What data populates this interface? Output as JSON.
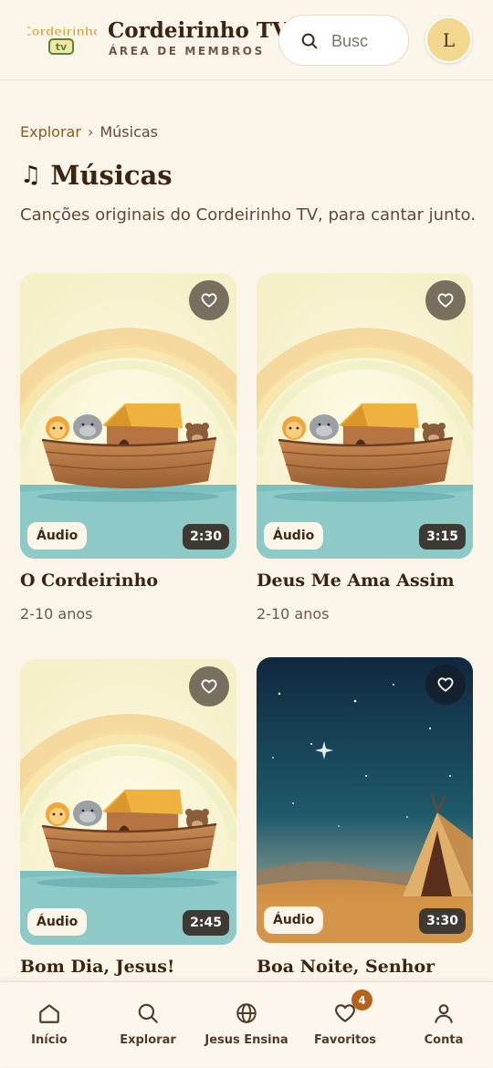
{
  "header": {
    "logo_text_top": "Cordeirinho",
    "logo_text_bottom": "tv",
    "brand_title": "Cordeirinho TV",
    "brand_subtitle": "ÁREA DE MEMBROS",
    "search_placeholder": "Busc",
    "avatar_initial": "L"
  },
  "breadcrumb": {
    "parent": "Explorar",
    "separator": "›",
    "current": "Músicas"
  },
  "page": {
    "icon": "♫",
    "title": "Músicas",
    "subtitle": "Canções originais do Cordeirinho TV, para cantar junto."
  },
  "cards": [
    {
      "title": "O Cordeirinho",
      "age": "2-10 anos",
      "type_tag": "Áudio",
      "duration": "2:30",
      "thumb": "ark"
    },
    {
      "title": "Deus Me Ama Assim",
      "age": "2-10 anos",
      "type_tag": "Áudio",
      "duration": "3:15",
      "thumb": "ark"
    },
    {
      "title": "Bom Dia, Jesus!",
      "age": "",
      "type_tag": "Áudio",
      "duration": "2:45",
      "thumb": "ark"
    },
    {
      "title": "Boa Noite, Senhor",
      "age": "",
      "type_tag": "Áudio",
      "duration": "3:30",
      "thumb": "night-tent"
    }
  ],
  "bottom_nav": [
    {
      "label": "Início",
      "icon": "home-icon"
    },
    {
      "label": "Explorar",
      "icon": "search-icon"
    },
    {
      "label": "Jesus Ensina",
      "icon": "globe-icon"
    },
    {
      "label": "Favoritos",
      "icon": "heart-icon",
      "badge": "4"
    },
    {
      "label": "Conta",
      "icon": "user-icon"
    }
  ],
  "colors": {
    "background": "#fbf4e9",
    "accent": "#8d5a20",
    "badge": "#b7621c",
    "avatar": "#f2d78e"
  }
}
